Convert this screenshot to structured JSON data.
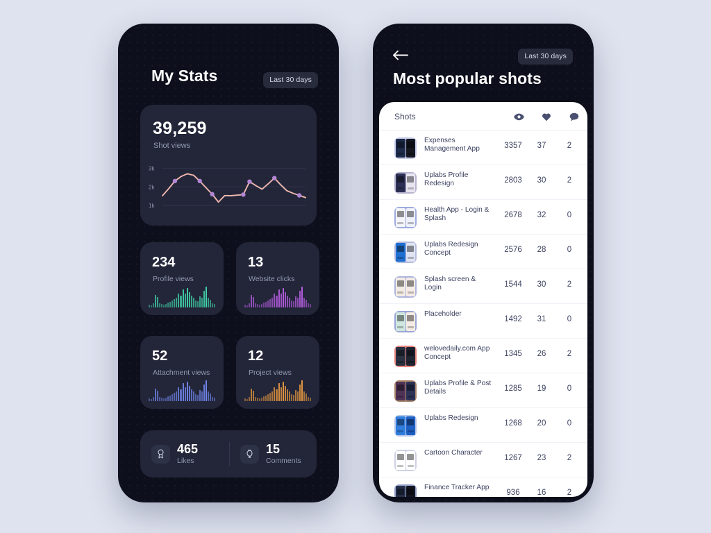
{
  "theme": {
    "page_bg": "#dfe3ef",
    "phone_bg": "#0d0f1c",
    "card_bg": "#232639",
    "sheet_bg": "#ffffff",
    "text_primary": "#ffffff",
    "text_muted": "#9299b2",
    "line_color": "#f0b8b0",
    "marker_color": "#b286d4"
  },
  "left_phone": {
    "title": "My Stats",
    "range_chip": "Last 30 days",
    "hero": {
      "value": "39,259",
      "label": "Shot views",
      "chart": {
        "type": "line",
        "ylabel": "",
        "xlabel": "",
        "ylim": [
          700,
          3200
        ],
        "yticks": [
          1000,
          2000,
          3000
        ],
        "ytick_labels": [
          "1k",
          "2k",
          "3k"
        ],
        "grid": true,
        "legend": "none",
        "series_name": "Shot views",
        "values": [
          1520,
          1900,
          2310,
          2560,
          2700,
          2620,
          2310,
          1950,
          1600,
          1180,
          1530,
          1520,
          1550,
          1580,
          2280,
          2070,
          1870,
          2160,
          2470,
          2110,
          1790,
          1650,
          1540,
          1420
        ],
        "marker_indices": [
          2,
          6,
          8,
          13,
          14,
          18,
          22
        ]
      }
    },
    "stats": [
      {
        "value": "234",
        "label": "Profile views",
        "accent": "#3fd1a7",
        "bars": [
          4,
          3,
          6,
          18,
          15,
          6,
          5,
          4,
          5,
          7,
          8,
          10,
          12,
          14,
          20,
          17,
          26,
          20,
          28,
          22,
          17,
          14,
          10,
          9,
          16,
          14,
          24,
          30,
          14,
          11,
          6,
          5
        ]
      },
      {
        "value": "13",
        "label": "Website clicks",
        "accent": "#b45ce0",
        "bars": [
          4,
          3,
          6,
          18,
          15,
          6,
          5,
          4,
          5,
          7,
          8,
          10,
          12,
          14,
          20,
          17,
          26,
          20,
          28,
          22,
          17,
          14,
          10,
          9,
          16,
          14,
          24,
          30,
          14,
          11,
          6,
          5
        ]
      },
      {
        "value": "52",
        "label": "Attachment views",
        "accent": "#6f84e8",
        "bars": [
          4,
          3,
          6,
          18,
          15,
          6,
          5,
          4,
          5,
          7,
          8,
          10,
          12,
          14,
          20,
          17,
          26,
          20,
          28,
          22,
          17,
          14,
          10,
          9,
          16,
          14,
          24,
          30,
          14,
          11,
          6,
          5
        ]
      },
      {
        "value": "12",
        "label": "Project views",
        "accent": "#e3973f",
        "bars": [
          4,
          3,
          6,
          18,
          15,
          6,
          5,
          4,
          5,
          7,
          8,
          10,
          12,
          14,
          20,
          17,
          26,
          20,
          28,
          22,
          17,
          14,
          10,
          9,
          16,
          14,
          24,
          30,
          14,
          11,
          6,
          5
        ]
      }
    ],
    "bottom": [
      {
        "value": "465",
        "label": "Likes",
        "icon": "award-ribbon-icon"
      },
      {
        "value": "15",
        "label": "Comments",
        "icon": "balloon-icon"
      }
    ]
  },
  "right_phone": {
    "back_icon": "arrow-left-icon",
    "range_chip": "Last 30 days",
    "title": "Most popular shots",
    "table": {
      "col_shots": "Shots",
      "col_views_icon": "eye-icon",
      "col_likes_icon": "heart-icon",
      "col_comments_icon": "comment-icon",
      "rows": [
        {
          "name": "Expenses Management App",
          "views": "3357",
          "likes": "37",
          "comments": "2",
          "thumb_bg": "#c7ccea",
          "thumb_a": "#1d2a4a",
          "thumb_b": "#14171f"
        },
        {
          "name": "Uplabs Profile Redesign",
          "views": "2803",
          "likes": "30",
          "comments": "2",
          "thumb_bg": "#b6b4cf",
          "thumb_a": "#2c2f54",
          "thumb_b": "#e9e6f2"
        },
        {
          "name": "Health App - Login & Splash",
          "views": "2678",
          "likes": "32",
          "comments": "0",
          "thumb_bg": "#9fabdf",
          "thumb_a": "#f4f5fb",
          "thumb_b": "#eef1fa"
        },
        {
          "name": "Uplabs Redesign Concept",
          "views": "2576",
          "likes": "28",
          "comments": "0",
          "thumb_bg": "#b5bbe0",
          "thumb_a": "#1f6fd0",
          "thumb_b": "#dfe3f2"
        },
        {
          "name": "Splash screen & Login",
          "views": "1544",
          "likes": "30",
          "comments": "2",
          "thumb_bg": "#aeb4dd",
          "thumb_a": "#f3ece4",
          "thumb_b": "#f6ece6"
        },
        {
          "name": "Placeholder",
          "views": "1492",
          "likes": "31",
          "comments": "0",
          "thumb_bg": "#9aa5d6",
          "thumb_a": "#cfe7df",
          "thumb_b": "#f4ece4"
        },
        {
          "name": "welovedaily.com App Concept",
          "views": "1345",
          "likes": "26",
          "comments": "2",
          "thumb_bg": "#e8867f",
          "thumb_a": "#2a3242",
          "thumb_b": "#1e2431"
        },
        {
          "name": "Uplabs Profile & Post Details",
          "views": "1285",
          "likes": "19",
          "comments": "0",
          "thumb_bg": "#a8866a",
          "thumb_a": "#4f3357",
          "thumb_b": "#2b3256"
        },
        {
          "name": "Uplabs Redesign",
          "views": "1268",
          "likes": "20",
          "comments": "0",
          "thumb_bg": "#b7c6ea",
          "thumb_a": "#2f7ddd",
          "thumb_b": "#1e5fc4"
        },
        {
          "name": "Cartoon Character",
          "views": "1267",
          "likes": "23",
          "comments": "2",
          "thumb_bg": "#cfd2e4",
          "thumb_a": "#ffffff",
          "thumb_b": "#ffffff"
        },
        {
          "name": "Finance Tracker App",
          "views": "936",
          "likes": "16",
          "comments": "2",
          "thumb_bg": "#96a0c9",
          "thumb_a": "#243049",
          "thumb_b": "#12161f"
        }
      ]
    }
  }
}
